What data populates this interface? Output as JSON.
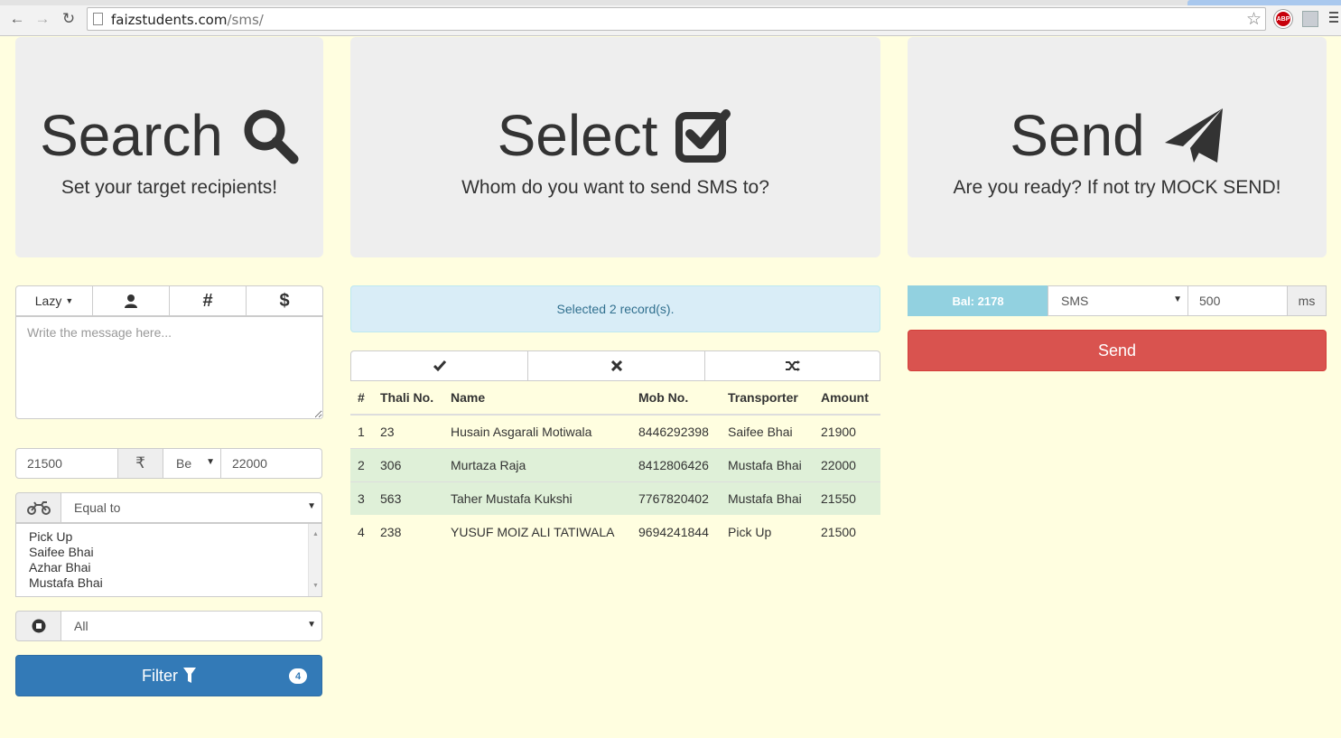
{
  "browser": {
    "url_host": "faizstudents.com",
    "url_path": "/sms/",
    "abp_label": "ABP"
  },
  "panels": {
    "search": {
      "title": "Search",
      "subtitle": "Set your target recipients!"
    },
    "select": {
      "title": "Select",
      "subtitle": "Whom do you want to send SMS to?"
    },
    "send": {
      "title": "Send",
      "subtitle": "Are you ready? If not try MOCK SEND!"
    }
  },
  "composer": {
    "template_dropdown": "Lazy",
    "person_icon": "user-icon",
    "hash_label": "#",
    "dollar_label": "$",
    "message_placeholder": "Write the message here..."
  },
  "amount_filter": {
    "min": "21500",
    "currency_symbol": "₹",
    "operator": "Be",
    "max": "22000"
  },
  "transporter_filter": {
    "icon": "motorcycle-icon",
    "condition": "Equal to",
    "options": [
      "Pick Up",
      "Saifee Bhai",
      "Azhar Bhai",
      "Mustafa Bhai"
    ]
  },
  "status_filter": {
    "icon": "stop-circle-icon",
    "value": "All"
  },
  "filter_button": {
    "label": "Filter",
    "badge": "4"
  },
  "selection": {
    "status": "Selected 2 record(s)."
  },
  "table": {
    "headers": [
      "#",
      "Thali No.",
      "Name",
      "Mob No.",
      "Transporter",
      "Amount"
    ],
    "rows": [
      [
        "1",
        "23",
        "Husain Asgarali Motiwala",
        "8446292398",
        "Saifee Bhai",
        "21900"
      ],
      [
        "2",
        "306",
        "Murtaza Raja",
        "8412806426",
        "Mustafa Bhai",
        "22000"
      ],
      [
        "3",
        "563",
        "Taher Mustafa Kukshi",
        "7767820402",
        "Mustafa Bhai",
        "21550"
      ],
      [
        "4",
        "238",
        "YUSUF MOIZ ALI TATIWALA",
        "9694241844",
        "Pick Up",
        "21500"
      ]
    ],
    "selected_rows": [
      false,
      true,
      true,
      false
    ]
  },
  "sender": {
    "balance": "Bal: 2178",
    "channel": "SMS",
    "delay": "500",
    "delay_unit": "ms",
    "send_label": "Send"
  },
  "colors": {
    "background": "#fffee0",
    "primary": "#337ab7",
    "danger": "#d9534f",
    "info": "#d9edf7",
    "success_row": "#dff0d8",
    "balance": "#92d1e0"
  }
}
